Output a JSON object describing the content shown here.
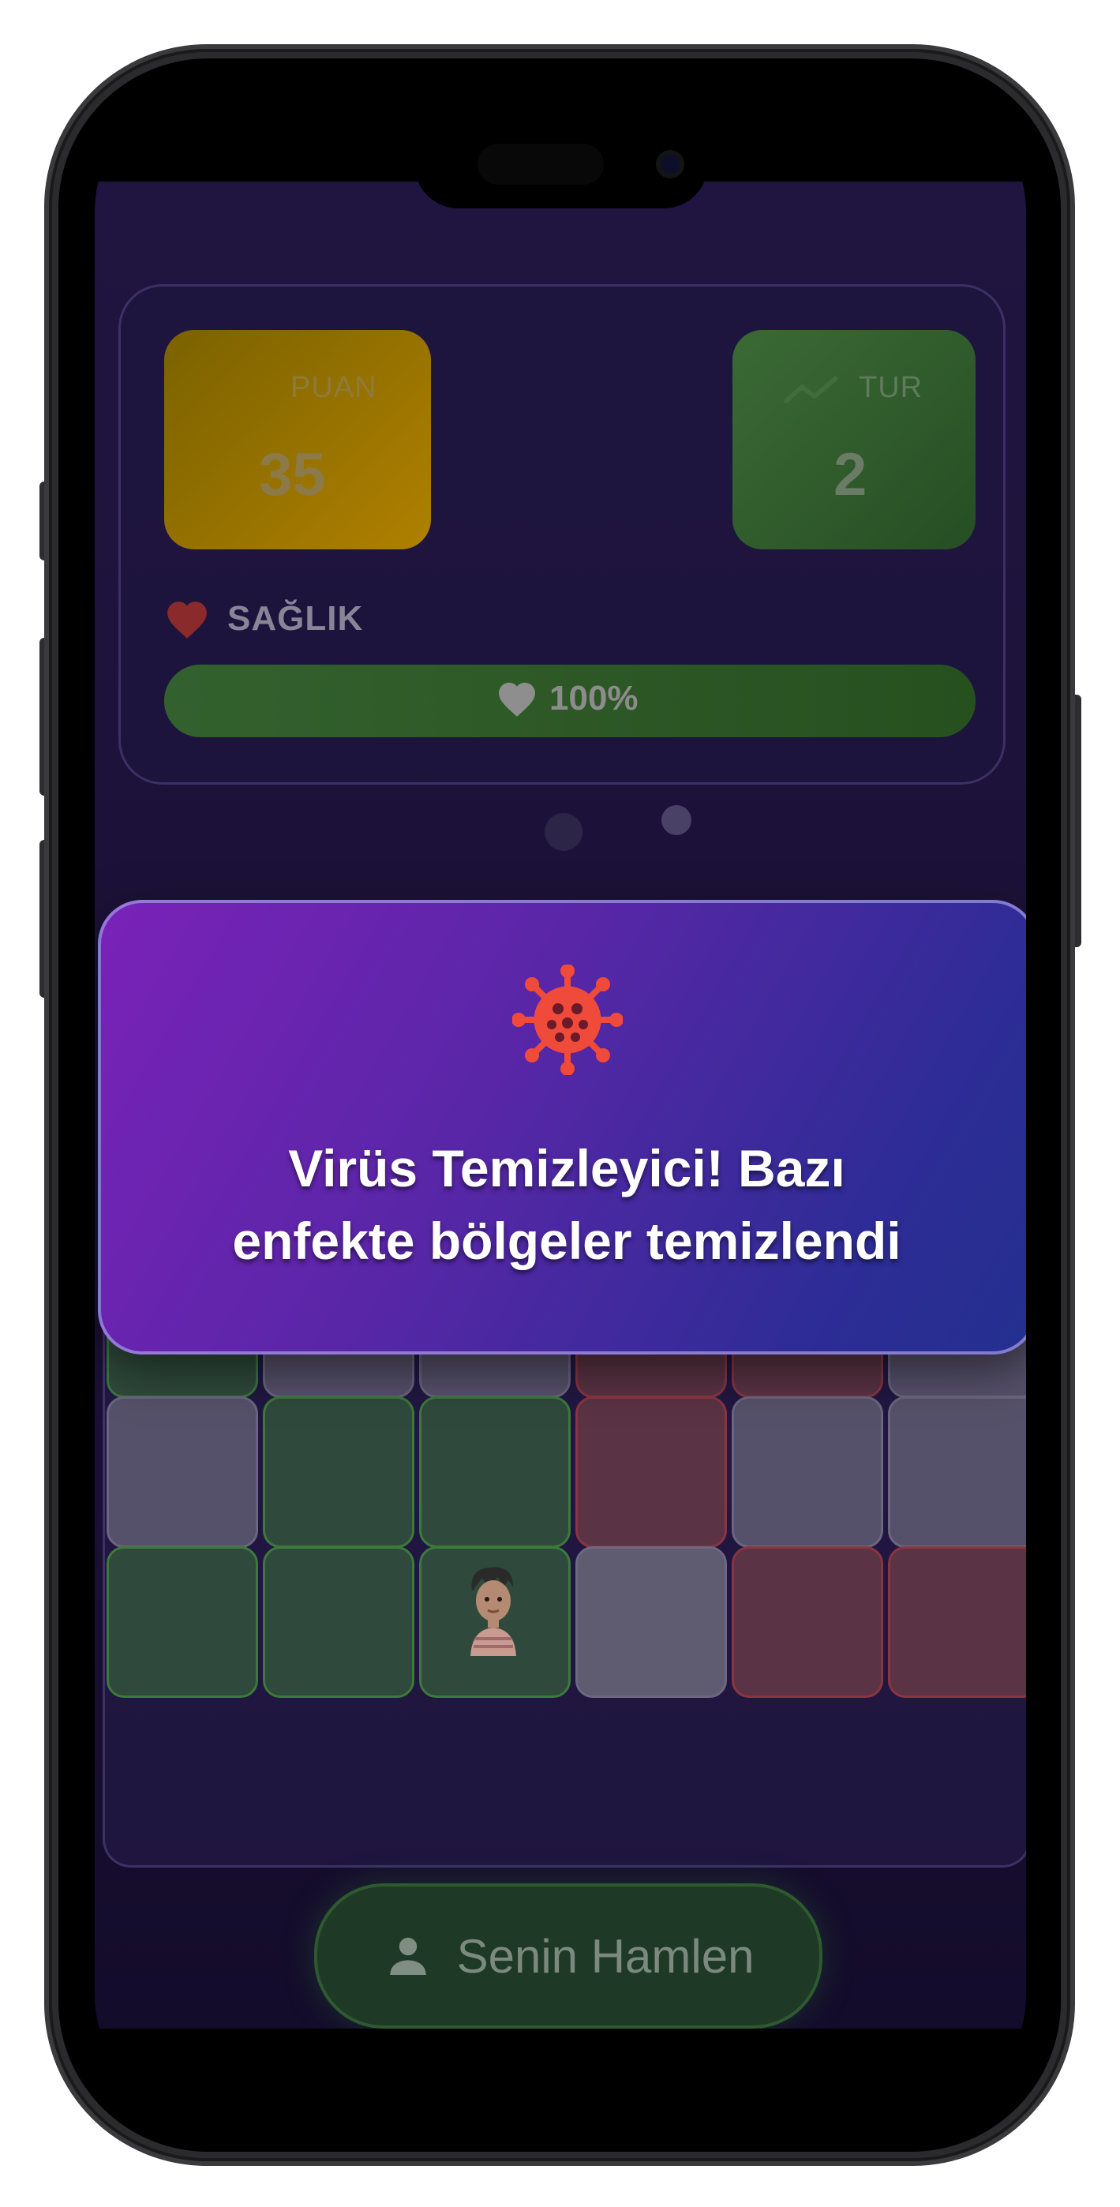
{
  "stats": {
    "score_label": "PUAN",
    "score_value": "35",
    "round_label": "TUR",
    "round_value": "2"
  },
  "health": {
    "label": "SAĞLIK",
    "value_text": "100%",
    "fraction": 1.0
  },
  "page_dots": {
    "count": 2,
    "active_index": 1
  },
  "board": {
    "columns": 6,
    "visible_rows": [
      [
        "gray",
        "gray",
        "gray",
        "green",
        "red",
        "gray"
      ],
      [
        "green",
        "gray",
        "gray",
        "red",
        "red",
        "gray"
      ],
      [
        "gray",
        "green",
        "green",
        "red",
        "gray",
        "gray"
      ],
      [
        "green",
        "green",
        "green",
        "lgray",
        "red",
        "red"
      ]
    ],
    "virus_cell": {
      "row": 1,
      "col": 3
    },
    "player_cell": {
      "row": 3,
      "col": 2
    }
  },
  "toast": {
    "icon": "virus-icon",
    "message_line1": "Virüs Temizleyici! Bazı",
    "message_line2": "enfekte bölgeler temizlendi",
    "icon_color": "#f04a3a"
  },
  "move_button": {
    "label": "Senin Hamlen",
    "icon": "person-icon"
  }
}
